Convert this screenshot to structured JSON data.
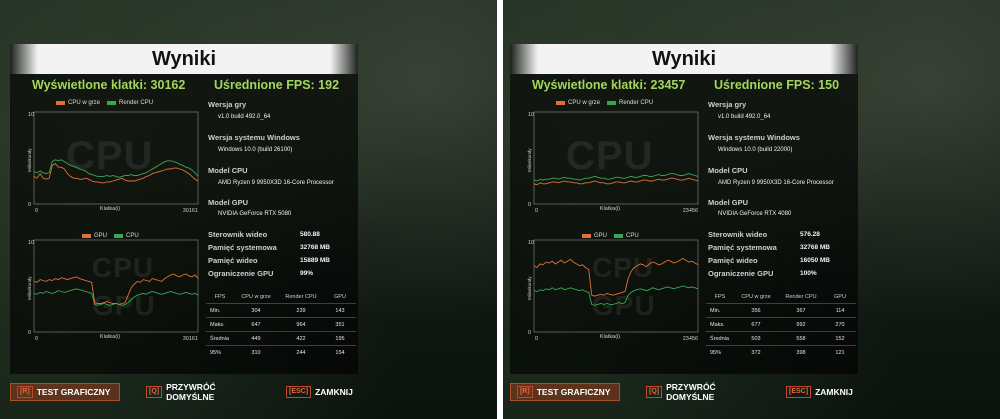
{
  "colors": {
    "cpu_game": "#e0703a",
    "render_cpu": "#3aa655",
    "gpu": "#e0703a",
    "cpu": "#3aa655",
    "accent_green": "#a4d65e"
  },
  "panels": [
    {
      "title": "Wyniki",
      "frames_label": "Wyświetlone klatki: 30162",
      "fps_label": "Uśrednione FPS: 192",
      "chart1": {
        "legend": [
          "CPU w grze",
          "Render CPU"
        ],
        "watermark": "CPU",
        "y_label": "Milisekundy",
        "x_label": "Klatka(i)",
        "y_top": "10",
        "y_bottom": "0",
        "x_left": "0",
        "x_right": "30161",
        "series_a": [
          0.3,
          0.28,
          0.33,
          0.28,
          0.27,
          0.28,
          0.42,
          0.44,
          0.4,
          0.4,
          0.38,
          0.33,
          0.3,
          0.28,
          0.28,
          0.27,
          0.27,
          0.28,
          0.27,
          0.25,
          0.24,
          0.24,
          0.23,
          0.23,
          0.24,
          0.24,
          0.25,
          0.26,
          0.27,
          0.28,
          0.26,
          0.25,
          0.25,
          0.25,
          0.26,
          0.27,
          0.28,
          0.3,
          0.31,
          0.33,
          0.34,
          0.35,
          0.36,
          0.37,
          0.38,
          0.38,
          0.39,
          0.39,
          0.38,
          0.37,
          0.35,
          0.33,
          0.3,
          0.27,
          0.25
        ],
        "series_b": [
          0.35,
          0.34,
          0.36,
          0.34,
          0.33,
          0.34,
          0.46,
          0.48,
          0.47,
          0.48,
          0.46,
          0.44,
          0.42,
          0.41,
          0.4,
          0.38,
          0.37,
          0.36,
          0.33,
          0.32,
          0.31,
          0.3,
          0.3,
          0.3,
          0.31,
          0.3,
          0.31,
          0.3,
          0.29,
          0.3,
          0.31,
          0.31,
          0.32,
          0.31,
          0.31,
          0.32,
          0.33,
          0.34,
          0.36,
          0.38,
          0.4,
          0.42,
          0.44,
          0.46,
          0.47,
          0.47,
          0.46,
          0.45,
          0.43,
          0.42,
          0.4,
          0.39,
          0.37,
          0.34,
          0.3
        ]
      },
      "chart2": {
        "legend": [
          "GPU",
          "CPU"
        ],
        "watermark_top": "CPU",
        "watermark_bottom": "GPU",
        "y_label": "Milisekundy",
        "x_label": "Klatka(i)",
        "y_top": "10",
        "y_bottom": "0",
        "x_left": "0",
        "x_right": "30161",
        "series_a": [
          0.55,
          0.54,
          0.57,
          0.56,
          0.55,
          0.57,
          0.56,
          0.58,
          0.57,
          0.59,
          0.58,
          0.57,
          0.58,
          0.59,
          0.6,
          0.58,
          0.57,
          0.56,
          0.55,
          0.54,
          0.32,
          0.31,
          0.31,
          0.32,
          0.33,
          0.32,
          0.31,
          0.31,
          0.3,
          0.31,
          0.32,
          0.4,
          0.48,
          0.52,
          0.55,
          0.54,
          0.57,
          0.56,
          0.55,
          0.58,
          0.57,
          0.56,
          0.55,
          0.58,
          0.6,
          0.62,
          0.63,
          0.61,
          0.6,
          0.62,
          0.63,
          0.61,
          0.6,
          0.62,
          0.58
        ],
        "series_b": [
          0.42,
          0.41,
          0.43,
          0.42,
          0.44,
          0.43,
          0.42,
          0.43,
          0.45,
          0.44,
          0.43,
          0.44,
          0.45,
          0.46,
          0.47,
          0.46,
          0.45,
          0.44,
          0.43,
          0.42,
          0.3,
          0.29,
          0.3,
          0.31,
          0.3,
          0.29,
          0.3,
          0.31,
          0.3,
          0.29,
          0.3,
          0.32,
          0.35,
          0.38,
          0.4,
          0.41,
          0.42,
          0.41,
          0.43,
          0.44,
          0.43,
          0.42,
          0.41,
          0.42,
          0.43,
          0.44,
          0.43,
          0.42,
          0.41,
          0.42,
          0.43,
          0.42,
          0.41,
          0.42,
          0.4
        ]
      },
      "info": [
        {
          "label": "Wersja gry",
          "value": "v1.0 build 492.0_64"
        },
        {
          "label": "Wersja systemu Windows",
          "value": "Windows 10.0 (build 26100)"
        },
        {
          "label": "Model CPU",
          "value": "AMD Ryzen 9 9950X3D 16-Core Processor"
        },
        {
          "label": "Model GPU",
          "value": "NVIDIA GeForce RTX 5080"
        }
      ],
      "kv": [
        {
          "label": "Sterownik wideo",
          "value": "580.88"
        },
        {
          "label": "Pamięć systemowa",
          "value": "32768 MB"
        },
        {
          "label": "Pamięć wideo",
          "value": "15889 MB"
        },
        {
          "label": "Ograniczenie GPU",
          "value": "99%"
        }
      ],
      "table": {
        "headers": [
          "FPS",
          "CPU w grze",
          "Render CPU",
          "GPU"
        ],
        "rows": [
          [
            "Min.",
            "304",
            "239",
            "143"
          ],
          [
            "Maks.",
            "647",
            "964",
            "351"
          ],
          [
            "Średnia",
            "449",
            "422",
            "195"
          ],
          [
            "95%",
            "310",
            "244",
            "154"
          ]
        ]
      },
      "buttons": [
        {
          "key": "[R]",
          "label": "TEST GRAFICZNY"
        },
        {
          "key": "[Q]",
          "label": "PRZYWRÓĆ DOMYŚLNE"
        },
        {
          "key": "[ESC]",
          "label": "ZAMKNIJ"
        }
      ]
    },
    {
      "title": "Wyniki",
      "frames_label": "Wyświetlone klatki: 23457",
      "fps_label": "Uśrednione FPS: 150",
      "chart1": {
        "legend": [
          "CPU w grze",
          "Render CPU"
        ],
        "watermark": "CPU",
        "y_label": "Milisekundy",
        "x_label": "Klatka(i)",
        "y_top": "10",
        "y_bottom": "0",
        "x_left": "0",
        "x_right": "23456",
        "series_a": [
          0.22,
          0.21,
          0.23,
          0.22,
          0.22,
          0.23,
          0.24,
          0.24,
          0.23,
          0.24,
          0.25,
          0.24,
          0.24,
          0.23,
          0.23,
          0.22,
          0.22,
          0.23,
          0.23,
          0.24,
          0.25,
          0.24,
          0.23,
          0.23,
          0.22,
          0.22,
          0.23,
          0.24,
          0.24,
          0.23,
          0.23,
          0.24,
          0.25,
          0.24,
          0.24,
          0.25,
          0.26,
          0.26,
          0.25,
          0.25,
          0.26,
          0.27,
          0.26,
          0.26,
          0.27,
          0.28,
          0.28,
          0.27,
          0.26,
          0.26,
          0.27,
          0.28,
          0.27,
          0.26,
          0.25
        ],
        "series_b": [
          0.26,
          0.25,
          0.27,
          0.26,
          0.27,
          0.27,
          0.28,
          0.28,
          0.27,
          0.28,
          0.29,
          0.28,
          0.28,
          0.27,
          0.27,
          0.26,
          0.27,
          0.28,
          0.28,
          0.29,
          0.3,
          0.29,
          0.28,
          0.28,
          0.27,
          0.27,
          0.28,
          0.29,
          0.29,
          0.28,
          0.28,
          0.29,
          0.3,
          0.29,
          0.29,
          0.3,
          0.31,
          0.31,
          0.3,
          0.3,
          0.31,
          0.32,
          0.31,
          0.31,
          0.32,
          0.33,
          0.33,
          0.32,
          0.31,
          0.31,
          0.32,
          0.33,
          0.32,
          0.31,
          0.3
        ]
      },
      "chart2": {
        "legend": [
          "GPU",
          "CPU"
        ],
        "watermark_top": "CPU",
        "watermark_bottom": "GPU",
        "y_label": "Milisekundy",
        "x_label": "Klatka(i)",
        "y_top": "10",
        "y_bottom": "0",
        "x_left": "0",
        "x_right": "23456",
        "series_a": [
          0.72,
          0.7,
          0.74,
          0.73,
          0.76,
          0.75,
          0.77,
          0.74,
          0.76,
          0.78,
          0.75,
          0.77,
          0.79,
          0.76,
          0.74,
          0.72,
          0.73,
          0.7,
          0.68,
          0.4,
          0.39,
          0.4,
          0.41,
          0.4,
          0.42,
          0.41,
          0.4,
          0.41,
          0.42,
          0.43,
          0.44,
          0.58,
          0.66,
          0.7,
          0.72,
          0.74,
          0.73,
          0.71,
          0.74,
          0.76,
          0.75,
          0.73,
          0.74,
          0.76,
          0.78,
          0.77,
          0.75,
          0.76,
          0.78,
          0.8,
          0.78,
          0.76,
          0.77,
          0.75,
          0.73
        ],
        "series_b": [
          0.45,
          0.44,
          0.46,
          0.45,
          0.47,
          0.46,
          0.48,
          0.46,
          0.47,
          0.48,
          0.46,
          0.47,
          0.48,
          0.47,
          0.46,
          0.45,
          0.46,
          0.44,
          0.43,
          0.3,
          0.29,
          0.3,
          0.31,
          0.3,
          0.31,
          0.3,
          0.3,
          0.31,
          0.32,
          0.31,
          0.32,
          0.4,
          0.43,
          0.45,
          0.46,
          0.47,
          0.46,
          0.45,
          0.46,
          0.48,
          0.47,
          0.46,
          0.47,
          0.48,
          0.49,
          0.48,
          0.47,
          0.48,
          0.49,
          0.5,
          0.49,
          0.48,
          0.49,
          0.48,
          0.47
        ]
      },
      "info": [
        {
          "label": "Wersja gry",
          "value": "v1.0 build 492.0_64"
        },
        {
          "label": "Wersja systemu Windows",
          "value": "Windows 10.0 (build 22000)"
        },
        {
          "label": "Model CPU",
          "value": "AMD Ryzen 9 9950X3D 16-Core Processor"
        },
        {
          "label": "Model GPU",
          "value": "NVIDIA GeForce RTX 4080"
        }
      ],
      "kv": [
        {
          "label": "Sterownik wideo",
          "value": "576.28"
        },
        {
          "label": "Pamięć systemowa",
          "value": "32768 MB"
        },
        {
          "label": "Pamięć wideo",
          "value": "16050 MB"
        },
        {
          "label": "Ograniczenie GPU",
          "value": "100%"
        }
      ],
      "table": {
        "headers": [
          "FPS",
          "CPU w grze",
          "Render CPU",
          "GPU"
        ],
        "rows": [
          [
            "Min.",
            "356",
            "367",
            "114"
          ],
          [
            "Maks.",
            "677",
            "992",
            "270"
          ],
          [
            "Średnia",
            "503",
            "558",
            "152"
          ],
          [
            "95%",
            "372",
            "398",
            "121"
          ]
        ]
      },
      "buttons": [
        {
          "key": "[R]",
          "label": "TEST GRAFICZNY"
        },
        {
          "key": "[Q]",
          "label": "PRZYWRÓĆ DOMYŚLNE"
        },
        {
          "key": "[ESC]",
          "label": "ZAMKNIJ"
        }
      ]
    }
  ]
}
